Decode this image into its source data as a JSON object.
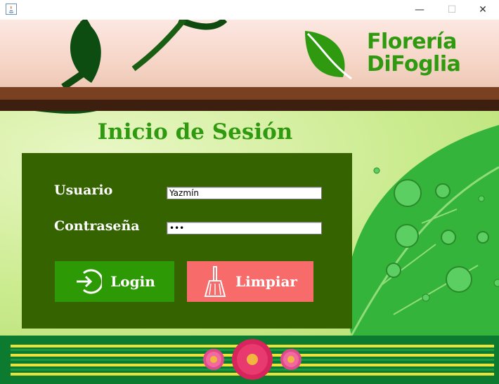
{
  "window": {
    "minimize_glyph": "—",
    "maximize_glyph": "☐",
    "close_glyph": "✕"
  },
  "brand": {
    "line1": "Florería",
    "line2": "DiFoglia",
    "color": "#2f9a0f"
  },
  "login": {
    "title": "Inicio de Sesión",
    "username_label": "Usuario",
    "username_value": "Yazmín",
    "password_label": "Contraseña",
    "password_value": "•••",
    "login_button": "Login",
    "clear_button": "Limpiar"
  },
  "colors": {
    "panel": "#346300",
    "login_button": "#2d9a05",
    "clear_button": "#f76b6b"
  }
}
